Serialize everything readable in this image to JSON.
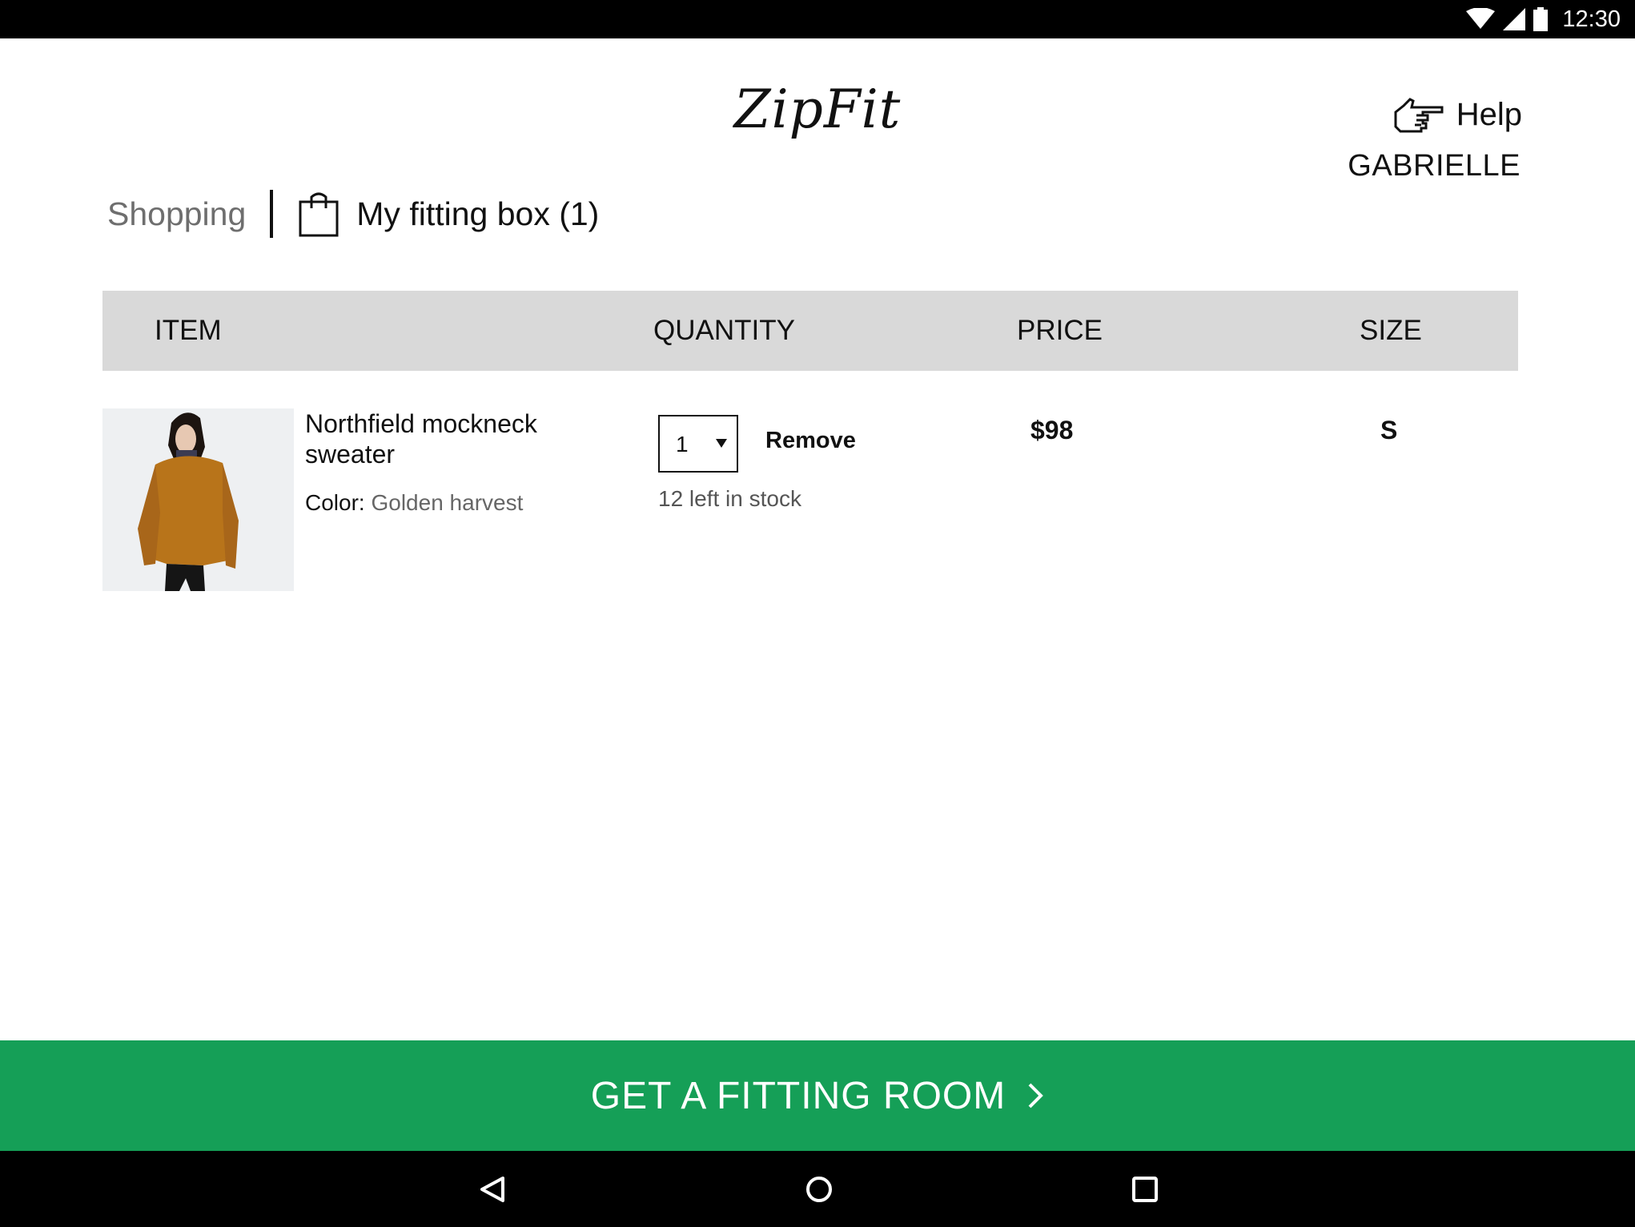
{
  "status_bar": {
    "time": "12:30",
    "icons": [
      "wifi-icon",
      "signal-icon",
      "battery-icon"
    ]
  },
  "header": {
    "logo": "ZipFit",
    "help_label": "Help",
    "help_icon": "pointing-hand-icon",
    "user_name": "GABRIELLE"
  },
  "nav": {
    "shopping_label": "Shopping",
    "fitting_box_label": "My fitting box (1)",
    "fitting_box_icon": "shopping-bag-icon"
  },
  "table": {
    "columns": {
      "item": "ITEM",
      "quantity": "QUANTITY",
      "price": "PRICE",
      "size": "SIZE"
    },
    "rows": [
      {
        "name": "Northfield mockneck sweater",
        "color_label": "Color:",
        "color_value": "Golden harvest",
        "quantity": "1",
        "remove_label": "Remove",
        "stock": "12 left in stock",
        "price": "$98",
        "size": "S"
      }
    ]
  },
  "cta": {
    "label": "GET A FITTING ROOM",
    "icon": "chevron-right-icon"
  },
  "system_nav": {
    "buttons": [
      "back-icon",
      "home-icon",
      "recents-icon"
    ]
  },
  "colors": {
    "accent_green": "#159f57",
    "table_header_bg": "#d9d9d9",
    "sweater": "#b8741a"
  }
}
